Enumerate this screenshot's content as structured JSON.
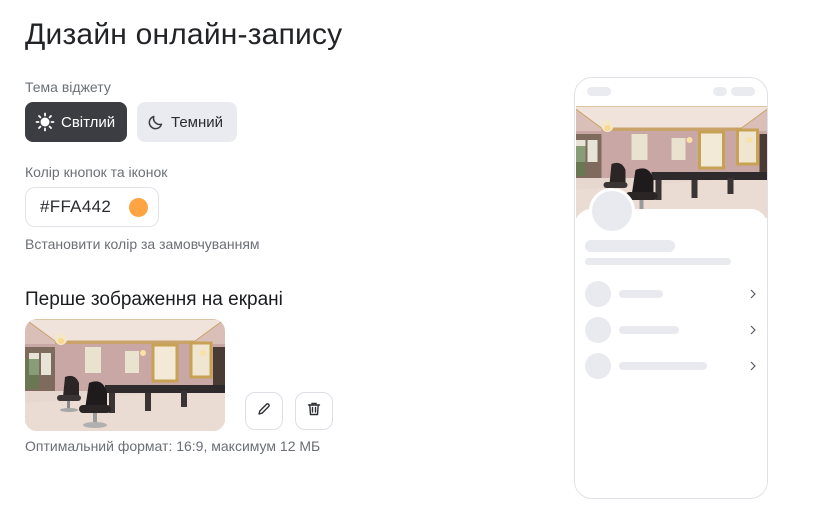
{
  "page": {
    "title": "Дизайн онлайн-запису"
  },
  "theme": {
    "label": "Тема віджету",
    "light_label": "Світлий",
    "dark_label": "Темний",
    "selected": "light"
  },
  "button_color": {
    "label": "Колір кнопок та іконок",
    "value": "#FFA442",
    "swatch": "#FFA442",
    "reset_label": "Встановити колір за замовчуванням"
  },
  "cover": {
    "title": "Перше зображення на екрані",
    "hint": "Оптимальний формат: 16:9, максимум 12 МБ",
    "edit_icon": "pencil-icon",
    "delete_icon": "trash-icon"
  },
  "colors": {
    "accent": "#FFA442",
    "active_button": "#3b3d42",
    "inactive_button": "#eaebf0",
    "skeleton": "#e9eaef"
  }
}
